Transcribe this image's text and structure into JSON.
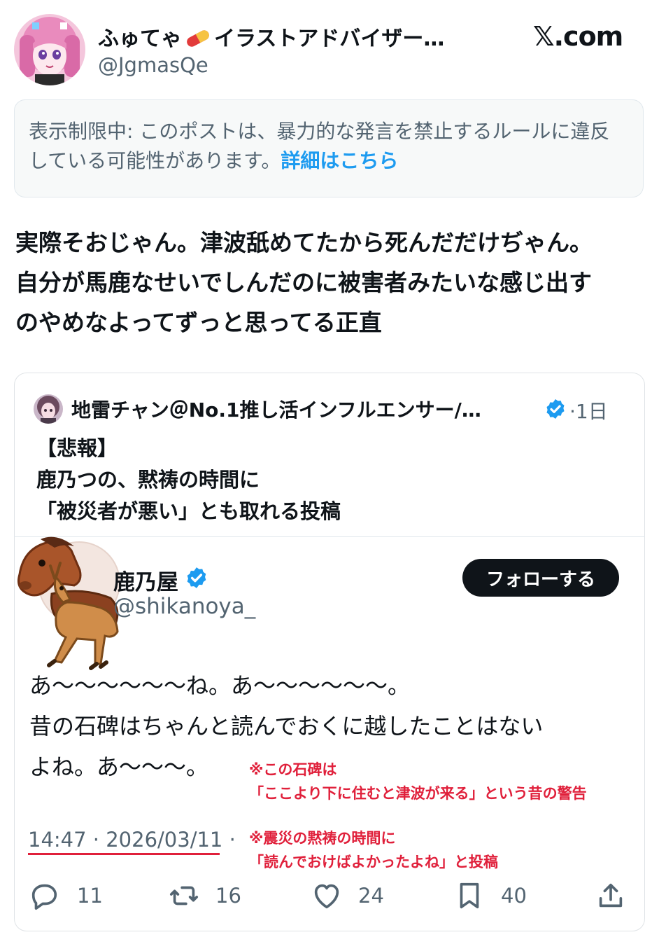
{
  "header": {
    "display_name_part1": "ふゅてゃ",
    "display_name_part2": "イラストアドバイザー…",
    "handle": "@JgmasQe",
    "site_logo": "𝕏.com",
    "icons": {
      "name_emoji": "pill-emoji",
      "avatar": "avatar"
    }
  },
  "notice": {
    "text": "表示制限中: このポストは、暴力的な発言を禁止するルールに違反している可能性があります。",
    "link_label": "詳細はこちら"
  },
  "post": {
    "lines": [
      "実際そおじゃん。津波舐めてたから死んだだけぢゃん。",
      "自分が馬鹿なせいでしんだのに被害者みたいな感じ出す",
      "のやめなよってずっと思ってる正直"
    ]
  },
  "quote": {
    "author": "地雷チャン＠No.1推し活インフルエンサー/…",
    "time": "·1日",
    "lines": [
      "【悲報】",
      "鹿乃つの、黙祷の時間に",
      "「被災者が悪い」とも取れる投稿"
    ],
    "embedded": {
      "name": "鹿乃屋",
      "handle": "@shikanoya_",
      "follow_label": "フォローする",
      "lines": [
        "あ〜〜〜〜〜〜ね。あ〜〜〜〜〜〜。",
        "昔の石碑はちゃんと読んでおくに越したことはない",
        "よね。あ〜〜〜。"
      ],
      "timestamp": "14:47 · 2026/03/11 ·",
      "note1": [
        "※この石碑は",
        "「ここより下に住むと津波が来る」という昔の警告"
      ],
      "note2": [
        "※震災の黙祷の時間に",
        "「読んでおけばよかったよね」と投稿"
      ],
      "counts": {
        "reply": "11",
        "retweet": "16",
        "like": "24",
        "bookmark": "40"
      }
    }
  },
  "colors": {
    "link": "#1d9bf0",
    "verified": "#1d9bf0",
    "annotation": "#e0203b",
    "secondary_text": "#536471"
  }
}
